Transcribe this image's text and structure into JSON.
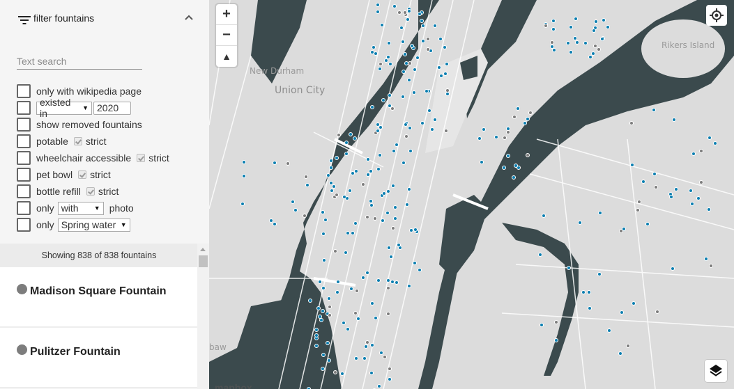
{
  "sidebar": {
    "title": "filter fountains",
    "search": {
      "placeholder": "Text search",
      "value": ""
    },
    "filters": {
      "wikipedia": "only with wikipedia page",
      "existed_mode": "existed in",
      "existed_year": "2020",
      "removed": "show removed fountains",
      "potable": "potable",
      "wheelchair": "wheelchair accessible",
      "pet_bowl": "pet bowl",
      "bottle_refill": "bottle refill",
      "strict": "strict",
      "only": "only",
      "photo_mode": "with",
      "photo": "photo",
      "water_type": "Spring water"
    },
    "result_count": "Showing 838 of 838 fountains",
    "results": [
      {
        "name": "Madison Square Fountain"
      },
      {
        "name": "Pulitzer Fountain"
      }
    ]
  },
  "map": {
    "labels": {
      "new_durham": "New Durham",
      "union_city": "Union City",
      "rikers": "Rikers Island",
      "bayonne": "baw",
      "attribution": "mapbox"
    },
    "controls": {
      "zoom_in": "+",
      "zoom_out": "−",
      "compass": "▲"
    },
    "colors": {
      "land": "#dcdcdc",
      "water": "#3b4a4d",
      "road": "#ffffff",
      "fountain_active": "#0d7fb0",
      "fountain_inactive": "#7d7d7d"
    },
    "icons": {
      "filter": "filter-icon",
      "collapse": "chevron-up-icon",
      "locate": "locate-icon",
      "layers": "layers-icon"
    }
  }
}
